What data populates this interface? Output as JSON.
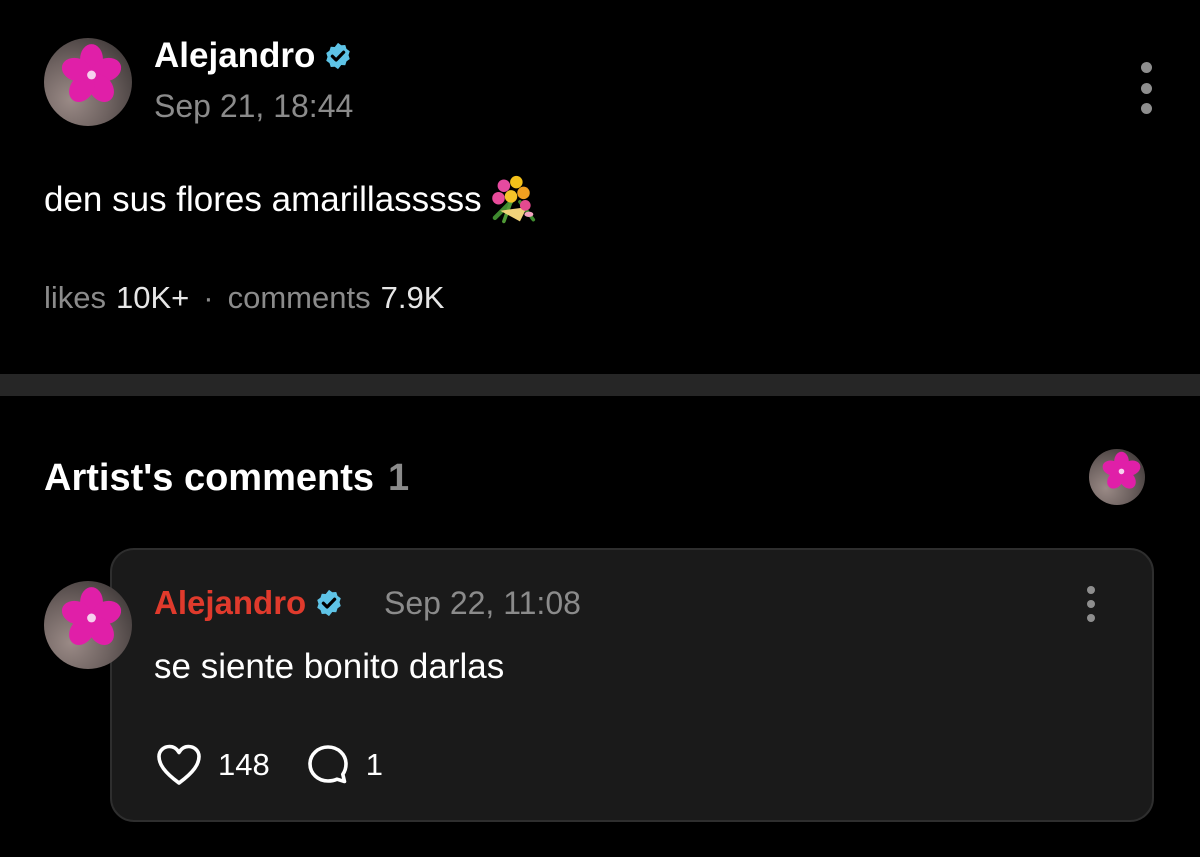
{
  "post": {
    "author": "Alejandro",
    "date": "Sep 21, 18:44",
    "text": "den sus flores amarillasssss",
    "emoji_icon": "bouquet-icon",
    "stats": {
      "likes_label": "likes",
      "likes_value": "10K+",
      "separator": "·",
      "comments_label": "comments",
      "comments_value": "7.9K"
    }
  },
  "artist_comments": {
    "title": "Artist's comments",
    "count": "1",
    "items": [
      {
        "author": "Alejandro",
        "date": "Sep 22, 11:08",
        "text": "se siente bonito darlas",
        "likes": "148",
        "replies": "1"
      }
    ]
  },
  "colors": {
    "background": "#000000",
    "verified_badge": "#5ec3e6",
    "comment_author": "#e03a2c",
    "muted_text": "#8b8b8b",
    "card_background": "#1a1a1a"
  }
}
